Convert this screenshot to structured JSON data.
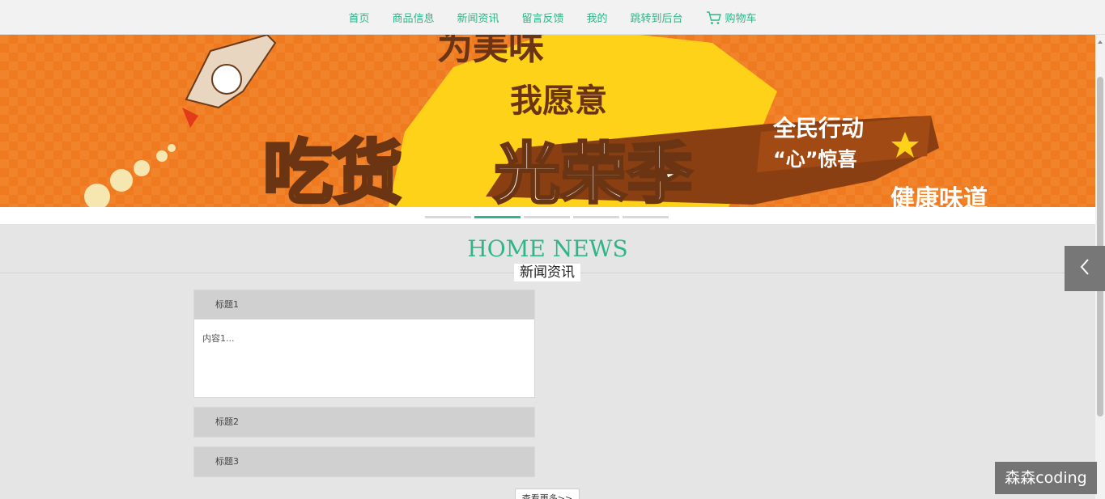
{
  "nav": {
    "items": [
      {
        "label": "首页"
      },
      {
        "label": "商品信息"
      },
      {
        "label": "新闻资讯"
      },
      {
        "label": "留言反馈"
      },
      {
        "label": "我的"
      },
      {
        "label": "跳转到后台"
      }
    ],
    "cart_label": "购物车",
    "cart_icon": "shopping-cart-icon",
    "accent_color": "#2fb58a"
  },
  "banner": {
    "line1": "为美味",
    "line2": "我愿意",
    "headline_a": "吃货",
    "headline_b": "光荣季",
    "ribbon": "全民行动",
    "sub_ribbon": "“心”惊喜",
    "corner_text": "健康味道",
    "slide_count": 5,
    "active_slide": 2
  },
  "news": {
    "title": "HOME NEWS",
    "subtitle": "新闻资讯",
    "items": [
      {
        "title": "标题1",
        "content": "内容1...",
        "expanded": true
      },
      {
        "title": "标题2",
        "content": "",
        "expanded": false
      },
      {
        "title": "标题3",
        "content": "",
        "expanded": false
      }
    ],
    "more_label": "查看更多>>"
  },
  "side": {
    "arrow_icon": "chevron-left-icon"
  },
  "watermark": "森森coding"
}
